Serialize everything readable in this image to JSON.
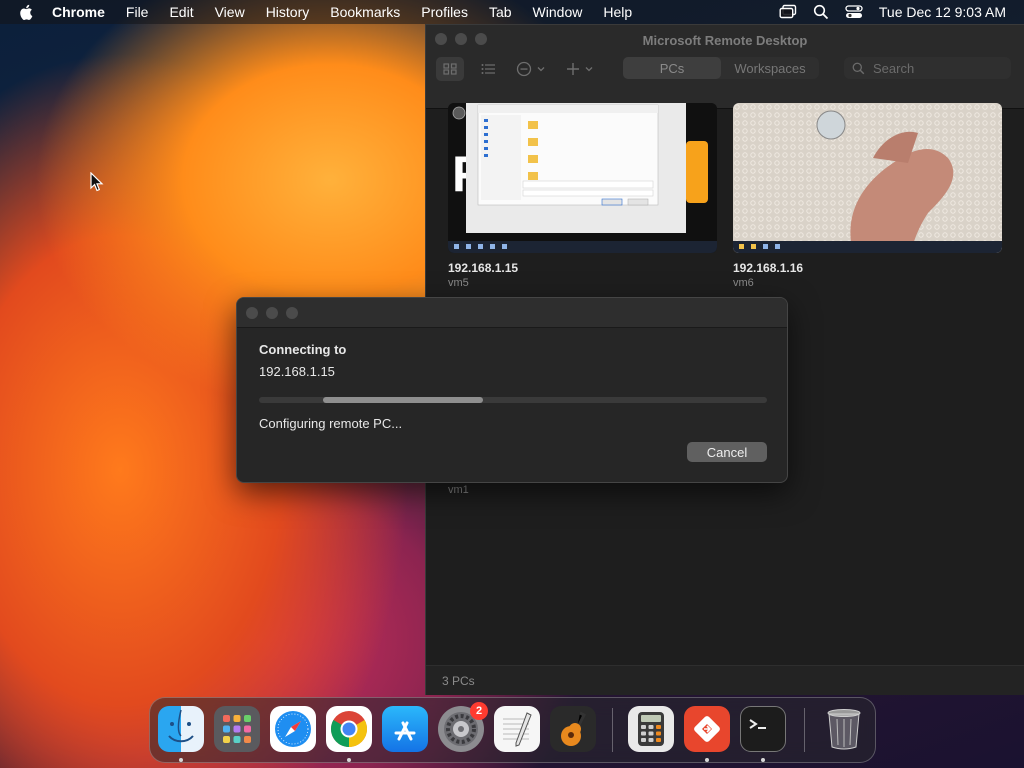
{
  "menubar": {
    "app_name": "Chrome",
    "items": [
      "File",
      "Edit",
      "View",
      "History",
      "Bookmarks",
      "Profiles",
      "Tab",
      "Window",
      "Help"
    ],
    "datetime": "Tue Dec 12  9:03 AM"
  },
  "rd_window": {
    "title": "Microsoft Remote Desktop",
    "tabs": [
      "PCs",
      "Workspaces"
    ],
    "selected_tab": "PCs",
    "search_placeholder": "Search",
    "pcs": [
      {
        "name": "192.168.1.15",
        "label": "vm5"
      },
      {
        "name": "192.168.1.16",
        "label": "vm6"
      },
      {
        "label": "vm1"
      }
    ],
    "footer_count": "3 PCs"
  },
  "dialog": {
    "heading": "Connecting to",
    "address": "192.168.1.15",
    "status": "Configuring remote PC...",
    "cancel_label": "Cancel",
    "progress_start": 0.125,
    "progress_end": 0.44
  },
  "dock": {
    "apps": [
      {
        "name": "Finder",
        "icon": "finder-icon",
        "running": true
      },
      {
        "name": "Launchpad",
        "icon": "launchpad-icon",
        "running": false
      },
      {
        "name": "Safari",
        "icon": "safari-icon",
        "running": false
      },
      {
        "name": "Google Chrome",
        "icon": "chrome-icon",
        "running": true
      },
      {
        "name": "App Store",
        "icon": "app-store-icon",
        "running": false
      },
      {
        "name": "System Settings",
        "icon": "settings-icon",
        "running": false,
        "badge": "2"
      },
      {
        "name": "TextEdit",
        "icon": "textedit-icon",
        "running": false
      },
      {
        "name": "GarageBand",
        "icon": "garageband-icon",
        "running": false
      },
      {
        "name": "Calculator",
        "icon": "calculator-icon",
        "running": false
      },
      {
        "name": "Microsoft Remote Desktop",
        "icon": "remote-desktop-icon",
        "running": true
      },
      {
        "name": "Terminal",
        "icon": "terminal-icon",
        "running": true
      },
      {
        "name": "Trash",
        "icon": "trash-icon",
        "running": false
      }
    ]
  },
  "colors": {
    "accent_orange": "#ff8c1a",
    "dialog_bg": "#262626",
    "badge_red": "#ff3b30",
    "remote_desktop_red": "#e8462d"
  }
}
